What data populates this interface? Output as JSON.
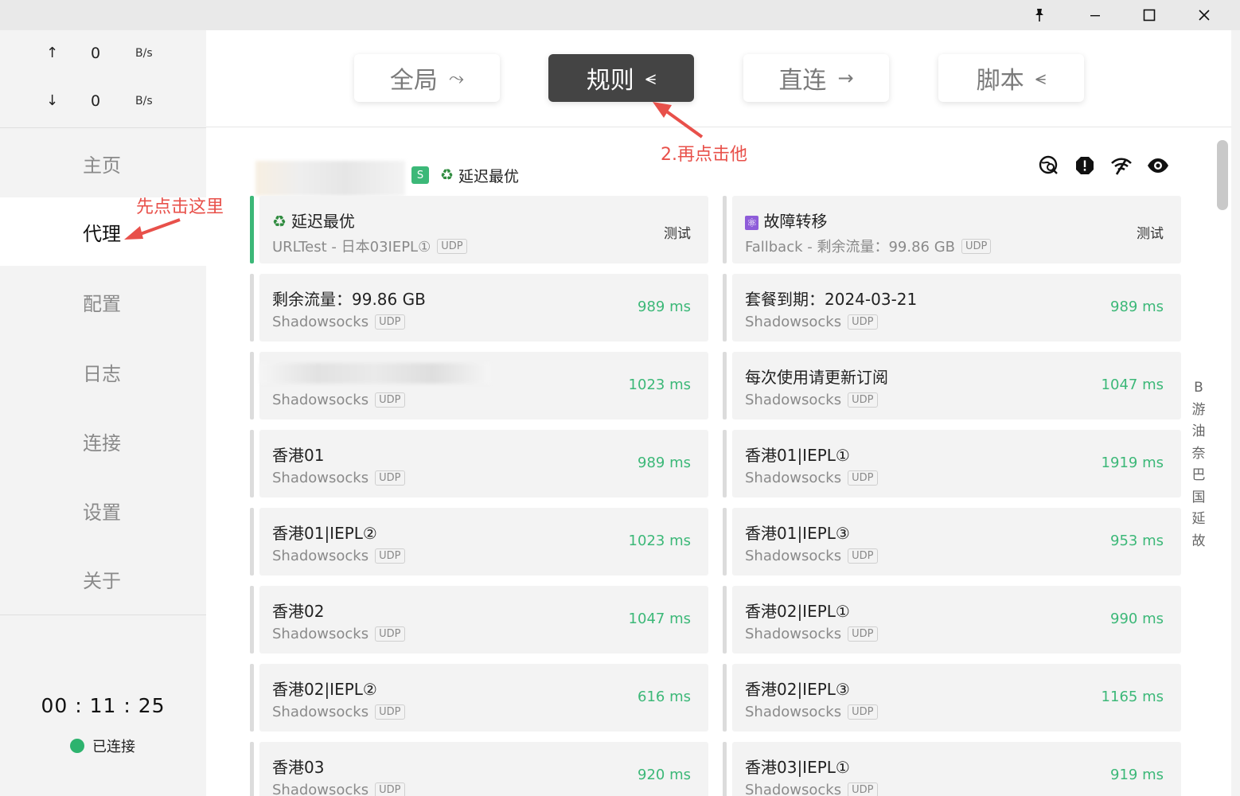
{
  "window": {
    "pin_icon": "pin-icon",
    "minimize_icon": "minimize-icon",
    "maximize_icon": "maximize-icon",
    "close_icon": "close-icon"
  },
  "sidebar": {
    "upload": {
      "arrow": "↑",
      "value": "0",
      "unit": "B/s"
    },
    "download": {
      "arrow": "↓",
      "value": "0",
      "unit": "B/s"
    },
    "nav": [
      {
        "label": "主页"
      },
      {
        "label": "代理"
      },
      {
        "label": "配置"
      },
      {
        "label": "日志"
      },
      {
        "label": "连接"
      },
      {
        "label": "设置"
      },
      {
        "label": "关于"
      }
    ],
    "active_nav": "代理",
    "uptime": "00 : 11 : 25",
    "status": "已连接",
    "status_color": "#2db36e"
  },
  "modes": [
    {
      "label": "全局",
      "icon": "⤳"
    },
    {
      "label": "规则",
      "icon": "⪪"
    },
    {
      "label": "直连",
      "icon": "→"
    },
    {
      "label": "脚本",
      "icon": "⪪"
    }
  ],
  "active_mode": "规则",
  "group": {
    "badge": "S",
    "icon": "♻",
    "title": "延迟最优",
    "tools": [
      "search-globe-icon",
      "alert-icon",
      "wifi-icon",
      "eye-icon"
    ]
  },
  "cards": [
    {
      "icon": "♻",
      "name": "延迟最优",
      "sub": "URLTest - 日本03IEPL①",
      "tag": "UDP",
      "action": "测试",
      "selected": true
    },
    {
      "icon": "⚛",
      "name": "故障转移",
      "sub": "Fallback - 剩余流量：99.86 GB",
      "tag": "UDP",
      "action": "测试"
    },
    {
      "name": "剩余流量：99.86 GB",
      "sub": "Shadowsocks",
      "tag": "UDP",
      "delay": "989 ms"
    },
    {
      "name": "套餐到期：2024-03-21",
      "sub": "Shadowsocks",
      "tag": "UDP",
      "delay": "989 ms"
    },
    {
      "name": "",
      "sub": "Shadowsocks",
      "tag": "UDP",
      "delay": "1023 ms",
      "blurred": true
    },
    {
      "name": "每次使用请更新订阅",
      "sub": "Shadowsocks",
      "tag": "UDP",
      "delay": "1047 ms"
    },
    {
      "name": "香港01",
      "sub": "Shadowsocks",
      "tag": "UDP",
      "delay": "989 ms"
    },
    {
      "name": "香港01|IEPL①",
      "sub": "Shadowsocks",
      "tag": "UDP",
      "delay": "1919 ms"
    },
    {
      "name": "香港01|IEPL②",
      "sub": "Shadowsocks",
      "tag": "UDP",
      "delay": "1023 ms"
    },
    {
      "name": "香港01|IEPL③",
      "sub": "Shadowsocks",
      "tag": "UDP",
      "delay": "953 ms"
    },
    {
      "name": "香港02",
      "sub": "Shadowsocks",
      "tag": "UDP",
      "delay": "1047 ms"
    },
    {
      "name": "香港02|IEPL①",
      "sub": "Shadowsocks",
      "tag": "UDP",
      "delay": "990 ms"
    },
    {
      "name": "香港02|IEPL②",
      "sub": "Shadowsocks",
      "tag": "UDP",
      "delay": "616 ms"
    },
    {
      "name": "香港02|IEPL③",
      "sub": "Shadowsocks",
      "tag": "UDP",
      "delay": "1165 ms"
    },
    {
      "name": "香港03",
      "sub": "Shadowsocks",
      "tag": "UDP",
      "delay": "920 ms"
    },
    {
      "name": "香港03|IEPL①",
      "sub": "Shadowsocks",
      "tag": "UDP",
      "delay": "919 ms"
    }
  ],
  "side_index": [
    "B",
    "游",
    "油",
    "奈",
    "巴",
    "国",
    "延",
    "故"
  ],
  "annotations": {
    "first": "先点击这里",
    "second": "2.再点击他",
    "color": "#e8504a"
  },
  "colors": {
    "accent_green": "#3cb878",
    "active_mode_bg": "#444444"
  }
}
